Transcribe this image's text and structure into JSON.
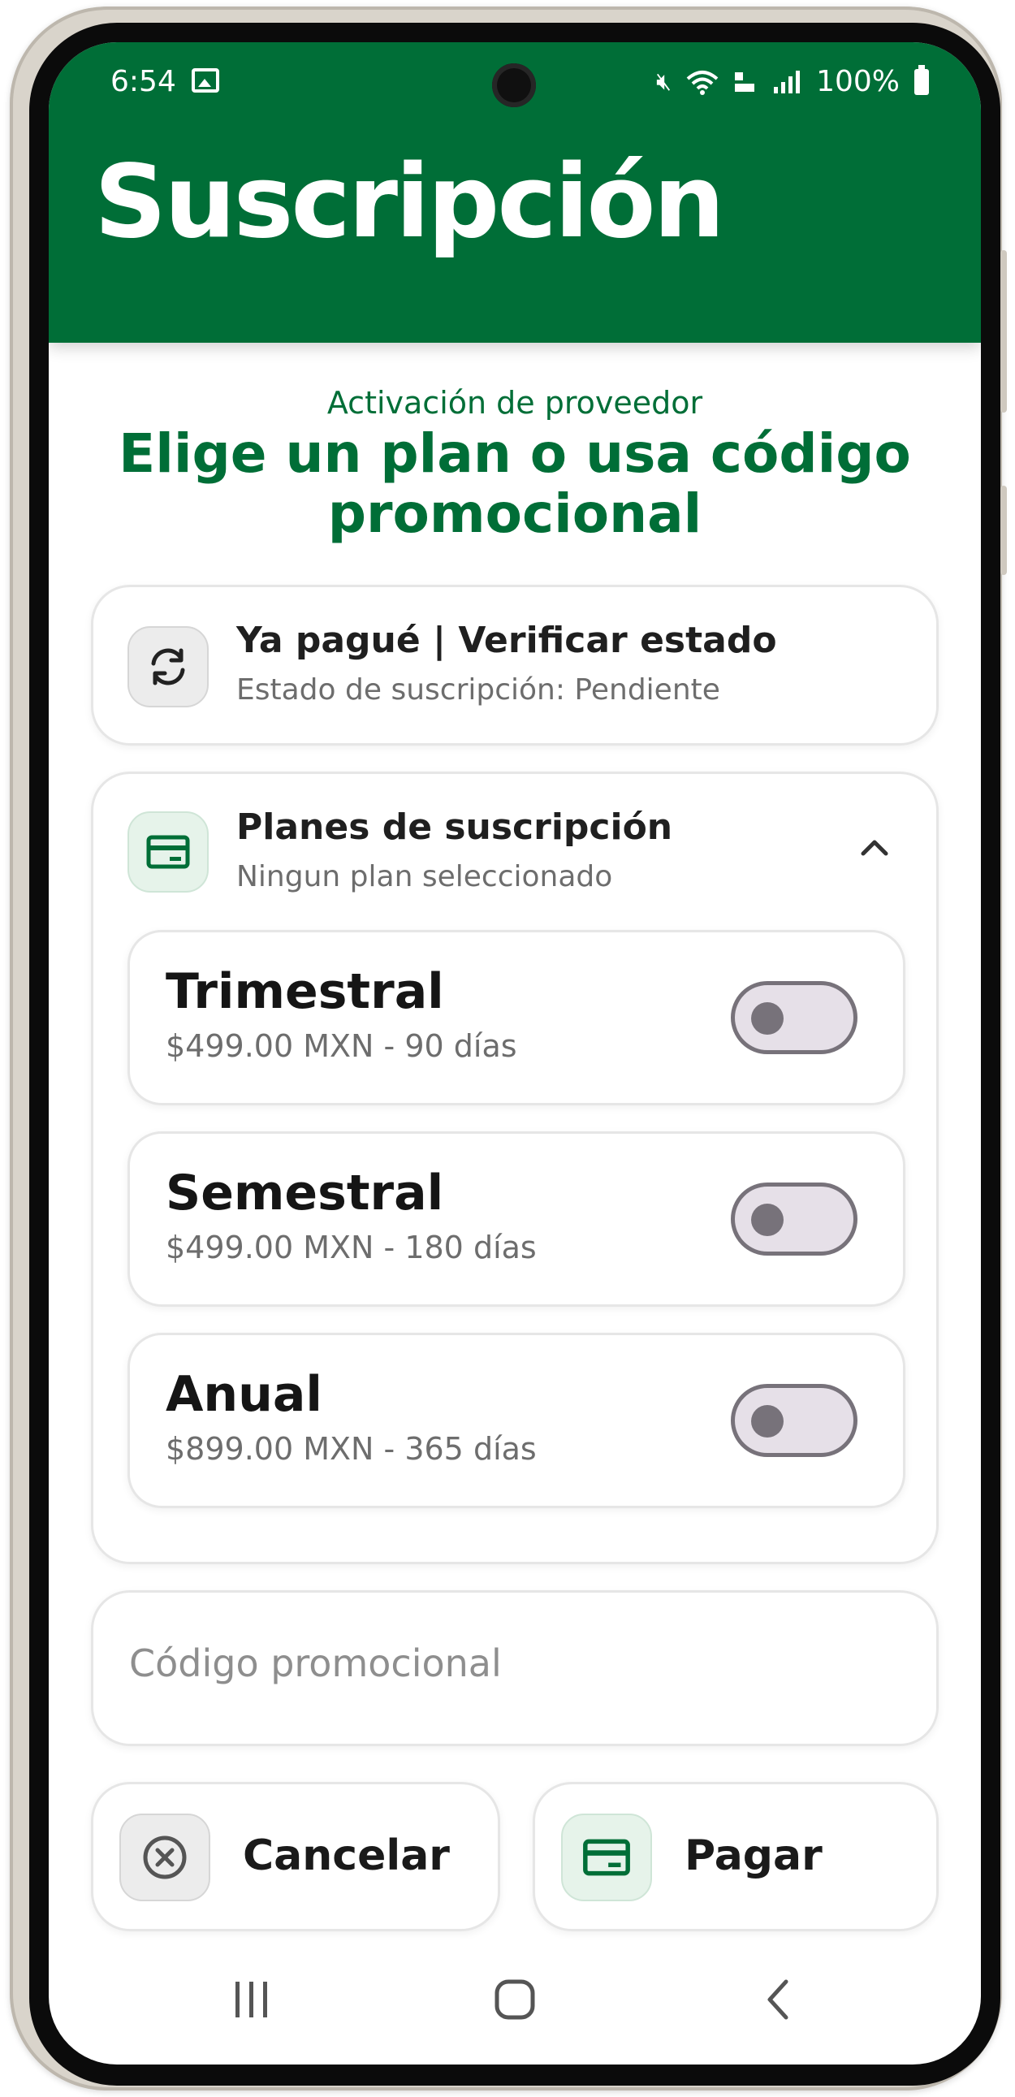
{
  "status_bar": {
    "time": "6:54",
    "battery": "100%",
    "icons": [
      "image-icon",
      "mute-icon",
      "wifi-icon",
      "volte-icon",
      "signal-icon",
      "battery-icon"
    ]
  },
  "header": {
    "title": "Suscripción",
    "bg_color": "#006e37"
  },
  "intro": {
    "kicker": "Activación de proveedor",
    "heading": "Elige un plan o usa código promocional"
  },
  "verify_card": {
    "title": "Ya pagué | Verificar estado",
    "subtitle": "Estado de suscripción: Pendiente",
    "icon": "refresh-icon"
  },
  "plans_card": {
    "title": "Planes de suscripción",
    "subtitle": "Ningun plan seleccionado",
    "icon": "credit-card-icon",
    "expanded": true,
    "plans": [
      {
        "name": "Trimestral",
        "detail": "$499.00 MXN - 90 días",
        "selected": false
      },
      {
        "name": "Semestral",
        "detail": "$499.00 MXN - 180 días",
        "selected": false
      },
      {
        "name": "Anual",
        "detail": "$899.00 MXN - 365 días",
        "selected": false
      }
    ]
  },
  "promo": {
    "placeholder": "Código promocional",
    "value": ""
  },
  "actions": {
    "cancel_label": "Cancelar",
    "pay_label": "Pagar"
  },
  "accent_color": "#006e37"
}
